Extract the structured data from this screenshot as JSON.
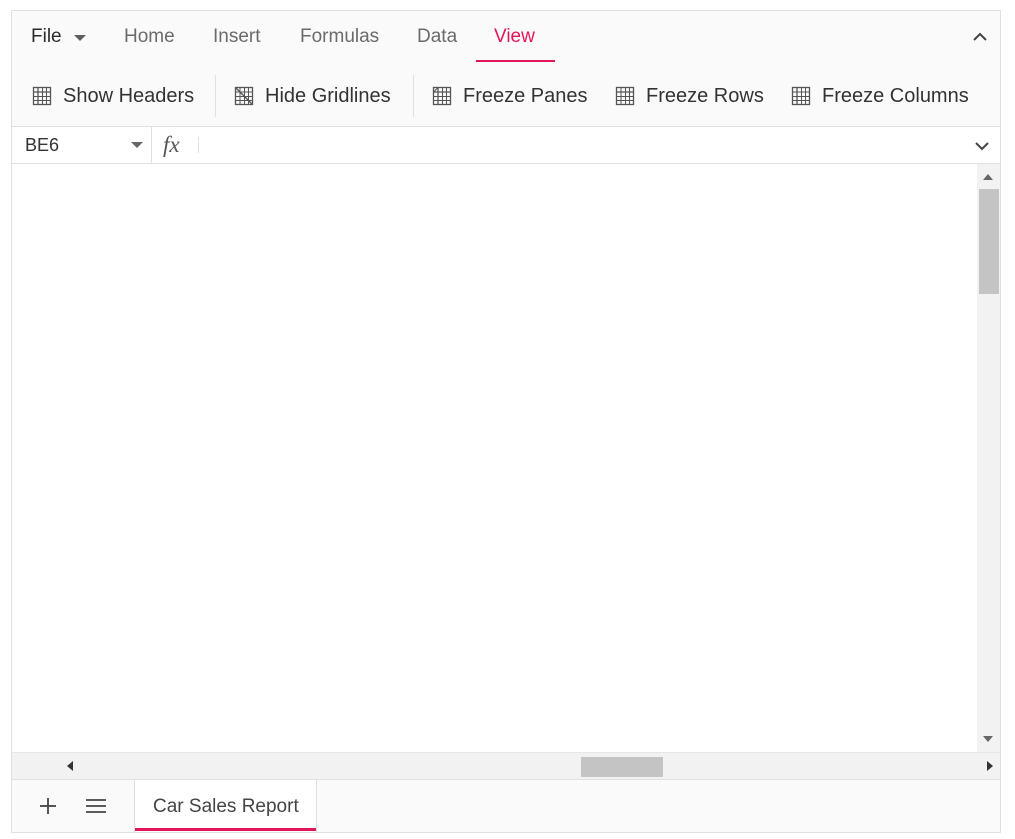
{
  "ribbon": {
    "tabs": [
      {
        "label": "File"
      },
      {
        "label": "Home"
      },
      {
        "label": "Insert"
      },
      {
        "label": "Formulas"
      },
      {
        "label": "Data"
      },
      {
        "label": "View"
      }
    ],
    "active_tab": "View",
    "accent_color": "#e3165b"
  },
  "toolbar": {
    "show_headers": "Show Headers",
    "hide_gridlines": "Hide Gridlines",
    "freeze_panes": "Freeze Panes",
    "freeze_rows": "Freeze Rows",
    "freeze_columns": "Freeze Columns"
  },
  "formula_bar": {
    "name_box": "BE6",
    "fx_label": "fx",
    "formula_value": ""
  },
  "sheets": {
    "tabs": [
      {
        "label": "Car Sales Report",
        "active": true
      }
    ]
  },
  "icons": {
    "collapse": "chevron-up-icon",
    "expand": "chevron-down-icon",
    "add_sheet": "plus-icon",
    "list_sheets": "hamburger-icon",
    "table": "table-grid-icon"
  }
}
